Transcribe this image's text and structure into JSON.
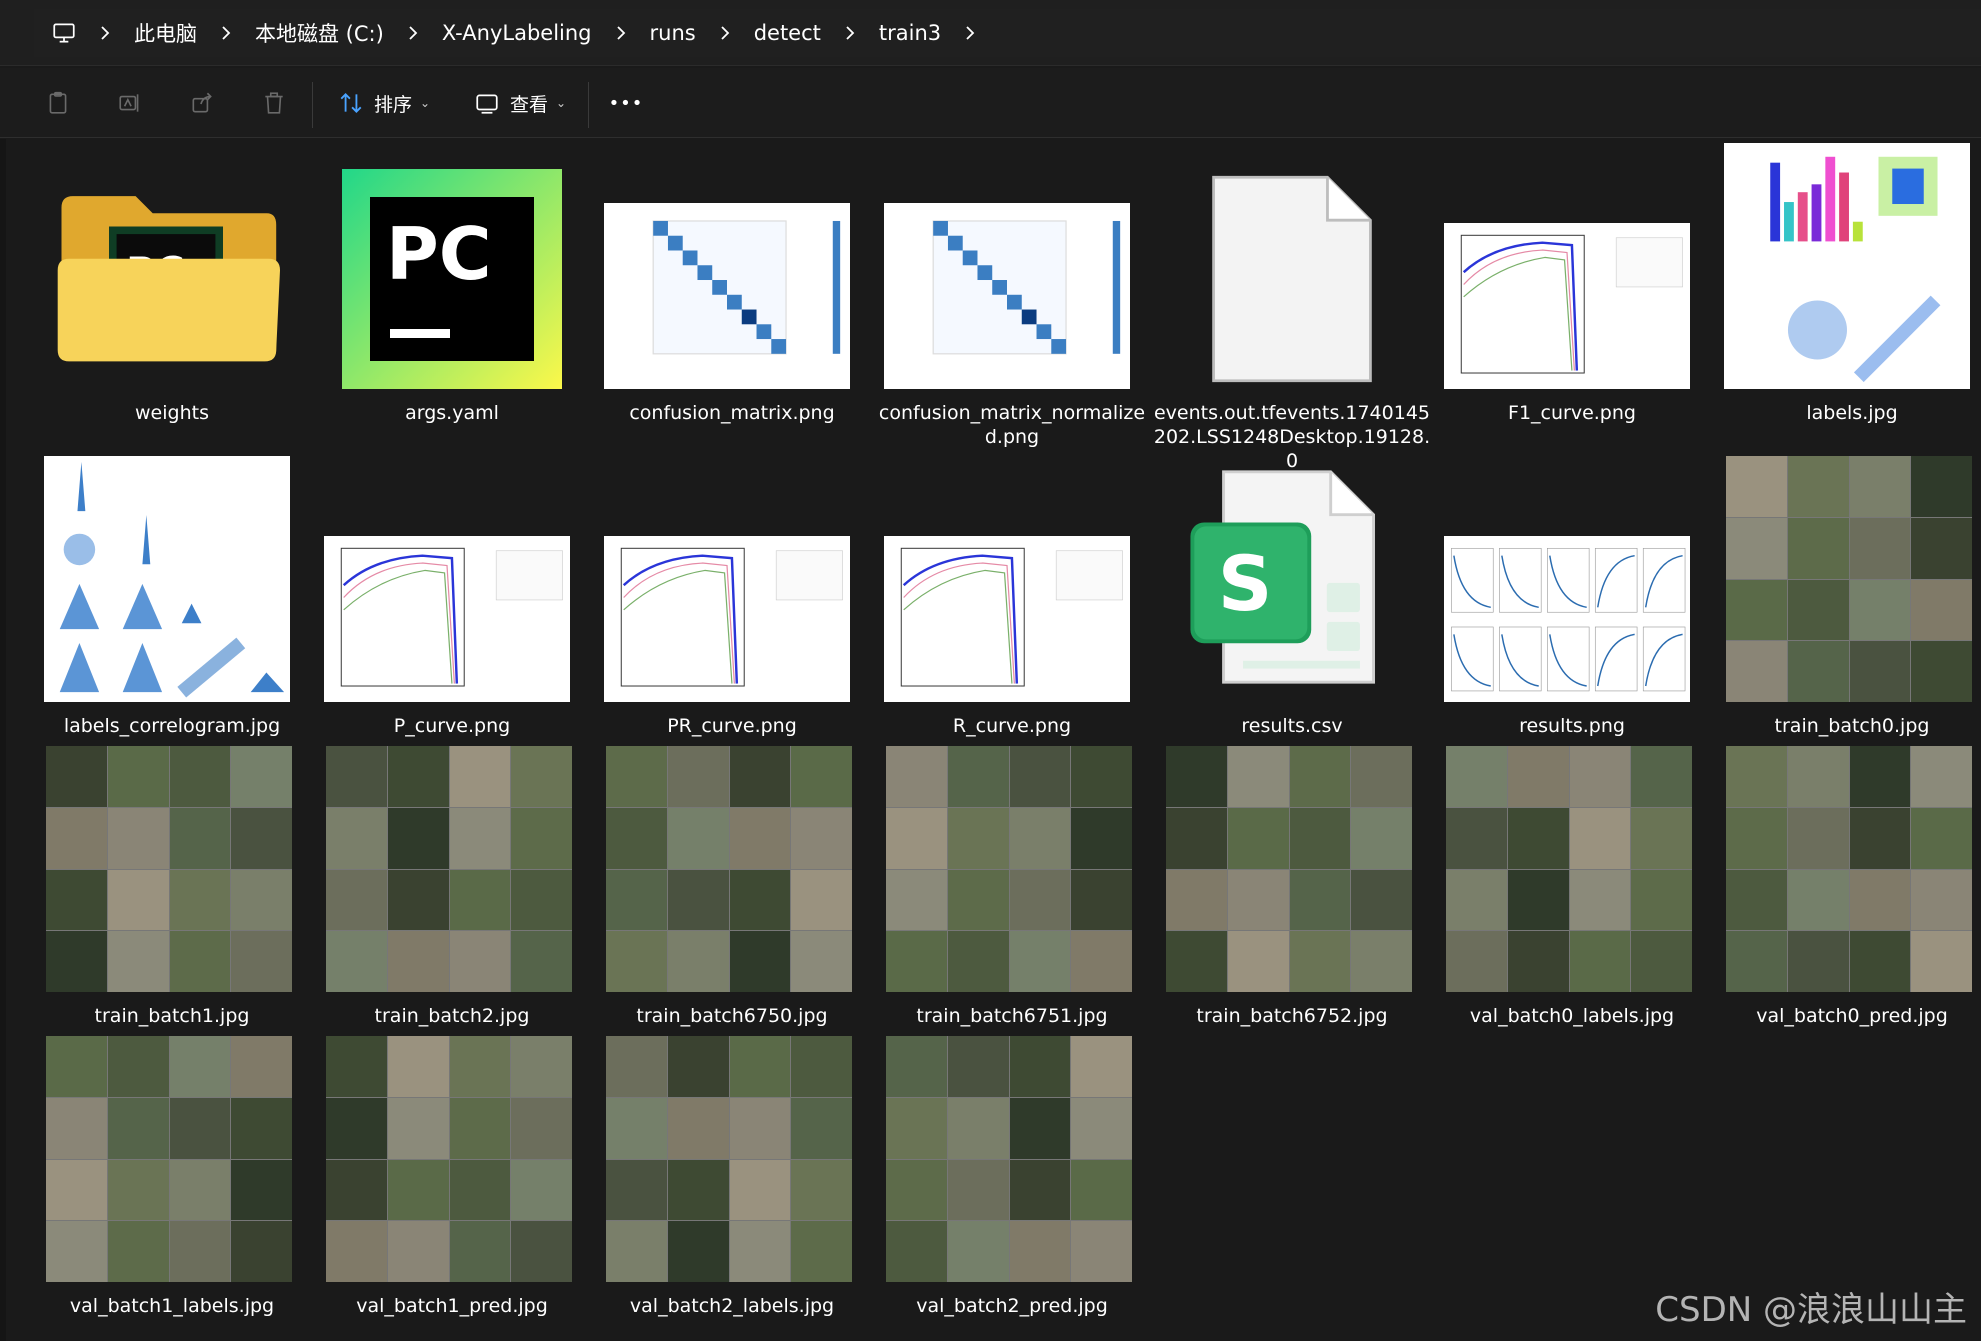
{
  "breadcrumb": [
    "此电脑",
    "本地磁盘 (C:)",
    "X-AnyLabeling",
    "runs",
    "detect",
    "train3"
  ],
  "toolbar": {
    "sort_label": "排序",
    "view_label": "查看",
    "more_label": "•••"
  },
  "files": [
    {
      "name": "weights",
      "kind": "folder"
    },
    {
      "name": "args.yaml",
      "kind": "pycharm"
    },
    {
      "name": "confusion_matrix.png",
      "kind": "matrix"
    },
    {
      "name": "confusion_matrix_normalized.png",
      "kind": "matrix"
    },
    {
      "name": "events.out.tfevents.1740145202.LSS1248Desktop.19128.0",
      "kind": "blank"
    },
    {
      "name": "F1_curve.png",
      "kind": "curve"
    },
    {
      "name": "labels.jpg",
      "kind": "labels"
    },
    {
      "name": "labels_correlogram.jpg",
      "kind": "correlogram"
    },
    {
      "name": "P_curve.png",
      "kind": "curve"
    },
    {
      "name": "PR_curve.png",
      "kind": "curve"
    },
    {
      "name": "R_curve.png",
      "kind": "curve"
    },
    {
      "name": "results.csv",
      "kind": "csv"
    },
    {
      "name": "results.png",
      "kind": "results"
    },
    {
      "name": "train_batch0.jpg",
      "kind": "photo"
    },
    {
      "name": "train_batch1.jpg",
      "kind": "photo"
    },
    {
      "name": "train_batch2.jpg",
      "kind": "photo"
    },
    {
      "name": "train_batch6750.jpg",
      "kind": "photo"
    },
    {
      "name": "train_batch6751.jpg",
      "kind": "photo"
    },
    {
      "name": "train_batch6752.jpg",
      "kind": "photo"
    },
    {
      "name": "val_batch0_labels.jpg",
      "kind": "photo"
    },
    {
      "name": "val_batch0_pred.jpg",
      "kind": "photo"
    },
    {
      "name": "val_batch1_labels.jpg",
      "kind": "photo"
    },
    {
      "name": "val_batch1_pred.jpg",
      "kind": "photo"
    },
    {
      "name": "val_batch2_labels.jpg",
      "kind": "photo"
    },
    {
      "name": "val_batch2_pred.jpg",
      "kind": "photo"
    }
  ],
  "watermark": "CSDN @浪浪山山主",
  "colors": {
    "background": "#1a1a1a",
    "text": "#ffffff",
    "folder": "#f7c948",
    "pycharm_green": "#21d789",
    "csv_green": "#1e9e5a"
  }
}
